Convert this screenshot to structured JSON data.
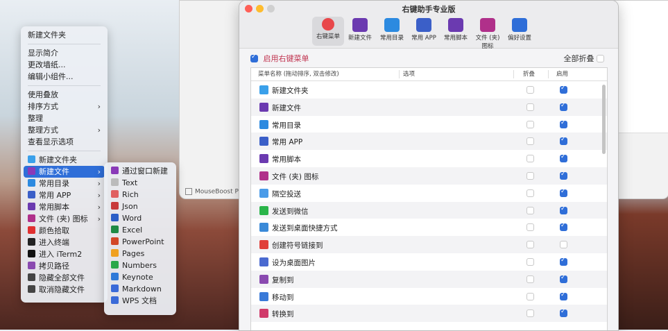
{
  "colors": {
    "accent": "#2f6ed8",
    "enable_label": "#c0334f"
  },
  "desktop_menu": {
    "items": [
      {
        "label": "新建文件夹"
      },
      {
        "label": "显示简介",
        "gap": true
      },
      {
        "label": "更改墙纸..."
      },
      {
        "label": "编辑小组件..."
      },
      {
        "label": "使用叠放",
        "gap": true
      },
      {
        "label": "排序方式",
        "arrow": true
      },
      {
        "label": "整理"
      },
      {
        "label": "整理方式",
        "arrow": true
      },
      {
        "label": "查看显示选项"
      }
    ],
    "tool_items": [
      {
        "label": "新建文件夹",
        "icon": "folder-icon",
        "color": "#3aa0ea"
      },
      {
        "label": "新建文件",
        "icon": "new-file-icon",
        "color": "#8a3ab8",
        "arrow": true,
        "active": true
      },
      {
        "label": "常用目录",
        "icon": "common-dir-icon",
        "color": "#2c8ae0",
        "arrow": true
      },
      {
        "label": "常用 APP",
        "icon": "app-store-icon",
        "color": "#3b5fc8",
        "arrow": true
      },
      {
        "label": "常用脚本",
        "icon": "script-icon",
        "color": "#6b3ab0",
        "arrow": true
      },
      {
        "label": "文件 (夹) 图标",
        "icon": "file-icon-icon",
        "color": "#b0308a",
        "arrow": true
      },
      {
        "label": "颜色拾取",
        "icon": "color-picker-icon",
        "color": "#e03030"
      },
      {
        "label": "进入终端",
        "icon": "terminal-icon",
        "color": "#222222"
      },
      {
        "label": "进入 iTerm2",
        "icon": "iterm-icon",
        "color": "#111111"
      },
      {
        "label": "拷贝路径",
        "icon": "copy-path-icon",
        "color": "#8a4ab0"
      },
      {
        "label": "隐藏全部文件",
        "icon": "hide-icon",
        "color": "#444444"
      },
      {
        "label": "取消隐藏文件",
        "icon": "eye-icon",
        "color": "#444444"
      }
    ]
  },
  "new_file_submenu": {
    "items": [
      {
        "label": "通过窗口新建",
        "icon": "window-new-icon",
        "color": "#8a3ab8"
      },
      {
        "label": "Text",
        "icon": "text-icon",
        "color": "#bbbbbb"
      },
      {
        "label": "Rich",
        "icon": "rich-text-icon",
        "color": "#e06060"
      },
      {
        "label": "Json",
        "icon": "json-icon",
        "color": "#c83a3a"
      },
      {
        "label": "Word",
        "icon": "word-icon",
        "color": "#2b5fc7"
      },
      {
        "label": "Excel",
        "icon": "excel-icon",
        "color": "#1e8a44"
      },
      {
        "label": "PowerPoint",
        "icon": "powerpoint-icon",
        "color": "#d24726"
      },
      {
        "label": "Pages",
        "icon": "pages-icon",
        "color": "#f0a020"
      },
      {
        "label": "Numbers",
        "icon": "numbers-icon",
        "color": "#2aa84a"
      },
      {
        "label": "Keynote",
        "icon": "keynote-icon",
        "color": "#2f7ad8"
      },
      {
        "label": "Markdown",
        "icon": "markdown-icon",
        "color": "#3a6ad8"
      },
      {
        "label": "WPS 文档",
        "icon": "wps-icon",
        "color": "#3a6ad8"
      }
    ]
  },
  "background_app": {
    "status": "MouseBoost PR"
  },
  "window": {
    "title": "右键助手专业版",
    "tabs": [
      {
        "label": "右键菜单",
        "icon": "context-menu-icon",
        "color": "#e8474a",
        "selected": true
      },
      {
        "label": "新建文件",
        "icon": "new-file-icon",
        "color": "#6b3ab0"
      },
      {
        "label": "常用目录",
        "icon": "common-dir-icon",
        "color": "#2c8ae0"
      },
      {
        "label": "常用 APP",
        "icon": "app-store-icon",
        "color": "#3b5fc8"
      },
      {
        "label": "常用脚本",
        "icon": "script-icon",
        "color": "#6b3ab0"
      },
      {
        "label": "文件 (夹) 图标",
        "icon": "file-icon-icon",
        "color": "#b0308a"
      },
      {
        "label": "偏好设置",
        "icon": "gear-icon",
        "color": "#2f6ed8"
      }
    ],
    "enable_label": "启用右键菜单",
    "collapse_all_label": "全部折叠",
    "table": {
      "headers": {
        "name": "菜单名称 (拖动排序, 双击修改)",
        "options": "选项",
        "fold": "折叠",
        "enable": "启用"
      },
      "rows": [
        {
          "label": "新建文件夹",
          "icon": "folder-icon",
          "color": "#3aa0ea",
          "enabled": true
        },
        {
          "label": "新建文件",
          "icon": "new-file-icon",
          "color": "#6b3ab0",
          "enabled": true
        },
        {
          "label": "常用目录",
          "icon": "common-dir-icon",
          "color": "#2c8ae0",
          "enabled": true
        },
        {
          "label": "常用 APP",
          "icon": "app-store-icon",
          "color": "#3b5fc8",
          "enabled": true
        },
        {
          "label": "常用脚本",
          "icon": "script-icon",
          "color": "#6b3ab0",
          "enabled": true
        },
        {
          "label": "文件 (夹) 图标",
          "icon": "file-icon-icon",
          "color": "#b0308a",
          "enabled": true
        },
        {
          "label": "隔空投送",
          "icon": "airdrop-icon",
          "color": "#4a9be8",
          "enabled": true
        },
        {
          "label": "发送到微信",
          "icon": "wechat-icon",
          "color": "#2bb54a",
          "enabled": true
        },
        {
          "label": "发送到桌面快捷方式",
          "icon": "shortcut-icon",
          "color": "#3a8ad8",
          "enabled": true
        },
        {
          "label": "创建符号链接到",
          "icon": "symlink-icon",
          "color": "#e0403a",
          "enabled": false
        },
        {
          "label": "设为桌面图片",
          "icon": "wallpaper-icon",
          "color": "#4a6ad0",
          "enabled": true
        },
        {
          "label": "复制到",
          "icon": "copy-to-icon",
          "color": "#8a4ab0",
          "enabled": true
        },
        {
          "label": "移动到",
          "icon": "move-to-icon",
          "color": "#3a7ad8",
          "enabled": true
        },
        {
          "label": "转换到",
          "icon": "convert-icon",
          "color": "#d03a6a",
          "enabled": true
        }
      ]
    }
  }
}
